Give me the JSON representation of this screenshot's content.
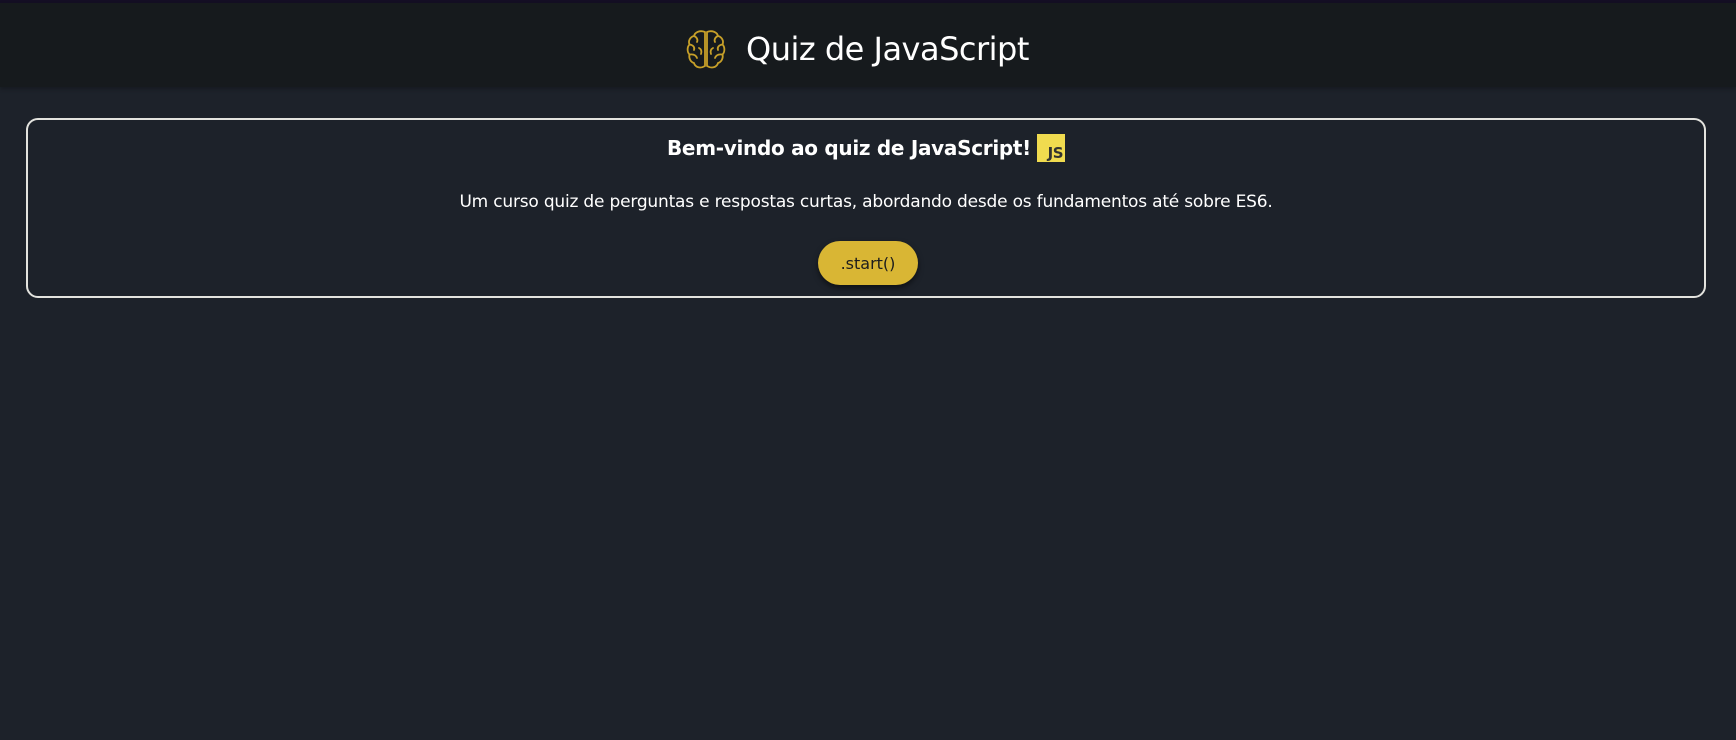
{
  "header": {
    "title": "Quiz de JavaScript",
    "icon": "brain-icon",
    "icon_color": "#c7a029",
    "background": "#161a1d"
  },
  "card": {
    "welcome": "Bem-vindo ao quiz de JavaScript!",
    "badge": "JS",
    "badge_color": "#f0db4f",
    "description": "Um curso quiz de perguntas e respostas curtas, abordando desde os fundamentos até sobre ES6.",
    "start_label": ".start()",
    "start_color": "#d9b634",
    "border_color": "#e3e3de"
  },
  "page": {
    "background": "#1d222a"
  }
}
